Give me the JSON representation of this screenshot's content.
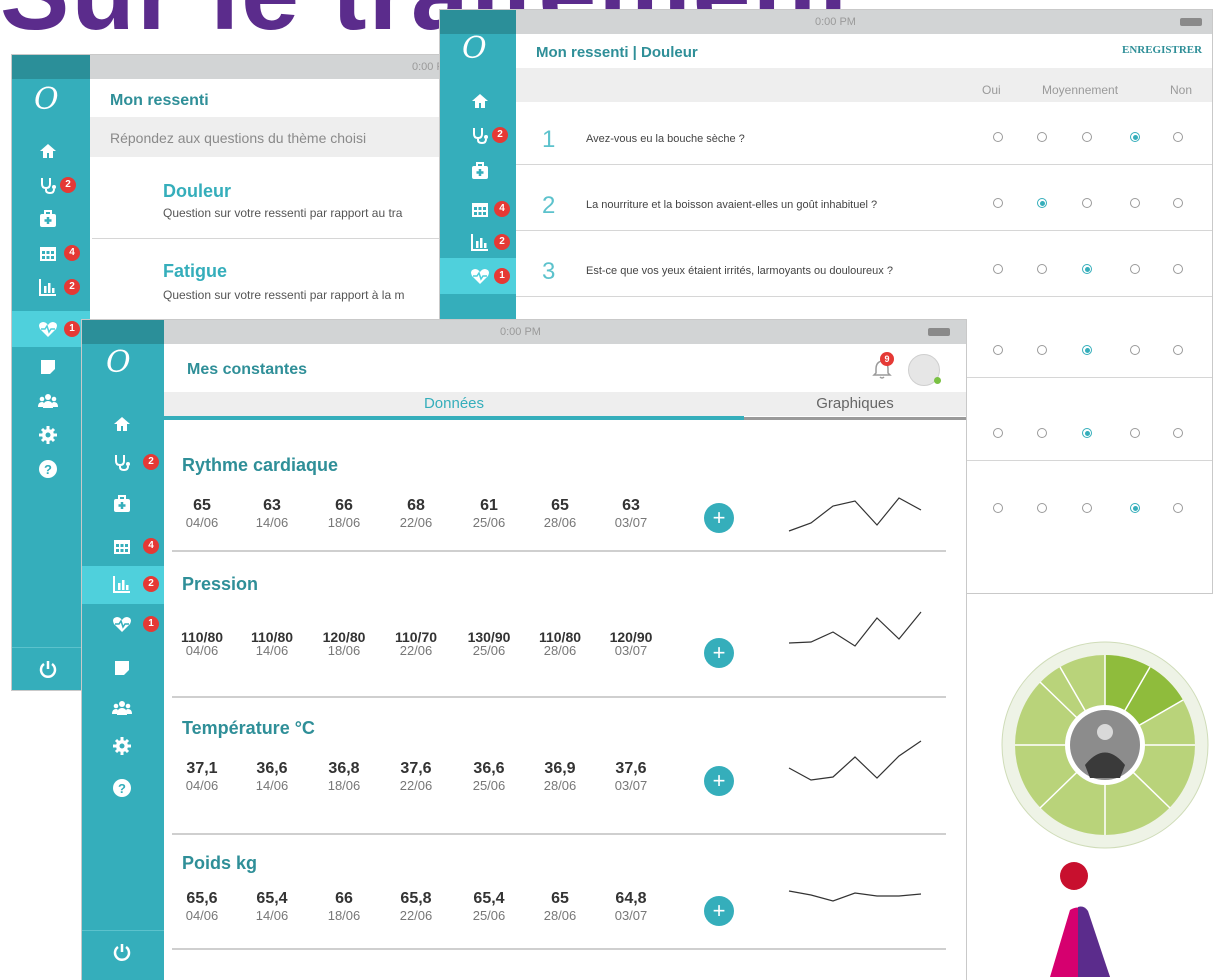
{
  "background_title": "Sur le traitement",
  "status_bar": {
    "time": "0:00 PM",
    "dots": "●●●●○"
  },
  "logo": "O",
  "sidebar_icons": [
    "home-icon",
    "stethoscope-icon",
    "medical-kit-icon",
    "calendar-icon",
    "bar-chart-icon",
    "heart-rate-icon",
    "note-icon",
    "group-icon",
    "settings-icon",
    "help-icon",
    "power-icon"
  ],
  "badges": {
    "stethoscope": "2",
    "calendar": "4",
    "chart": "2",
    "heart": "1",
    "notifications": "9"
  },
  "colors": {
    "accent": "#35aebb",
    "sidebar": "#35aebb",
    "active": "#4fd0dc",
    "badge": "#e53935",
    "title_purple": "#5b2c8c"
  },
  "ressenti": {
    "title": "Mon ressenti",
    "subtitle": "Répondez aux questions du thème choisi",
    "themes": [
      {
        "title": "Douleur",
        "desc": "Question sur votre ressenti par rapport au tra"
      },
      {
        "title": "Fatigue",
        "desc": "Question sur votre ressenti par rapport à la m"
      }
    ]
  },
  "douleur": {
    "title": "Mon ressenti | Douleur",
    "save_label": "ENREGISTRER",
    "columns": [
      "Oui",
      "Moyennement",
      "Non"
    ],
    "questions": [
      {
        "num": "1",
        "text": "Avez-vous eu la bouche sèche ?",
        "selected": 3
      },
      {
        "num": "2",
        "text": "La nourriture et la boisson avaient-elles un goût inhabituel ?",
        "selected": 1
      },
      {
        "num": "3",
        "text": "Est-ce que vos yeux étaient irrités, larmoyants ou douloureux ?",
        "selected": 2
      },
      {
        "num": "",
        "text": "",
        "selected": 2
      },
      {
        "num": "",
        "text": "",
        "selected": 2
      },
      {
        "num": "",
        "text": "",
        "selected": 3
      }
    ]
  },
  "constantes": {
    "title": "Mes constantes",
    "tabs": [
      "Données",
      "Graphiques"
    ],
    "active_tab": 0,
    "add_label": "+",
    "dates": [
      "04/06",
      "14/06",
      "18/06",
      "22/06",
      "25/06",
      "28/06",
      "03/07"
    ],
    "metrics": [
      {
        "name": "Rythme cardiaque",
        "values": [
          "65",
          "63",
          "66",
          "68",
          "61",
          "65",
          "63"
        ],
        "spark": [
          58,
          50,
          33,
          28,
          52,
          25,
          37
        ]
      },
      {
        "name": "Pression",
        "values": [
          "110/80",
          "110/80",
          "120/80",
          "110/70",
          "130/90",
          "110/80",
          "120/90"
        ],
        "spark": [
          39,
          38,
          28,
          42,
          14,
          35,
          8
        ]
      },
      {
        "name": "Température  °C",
        "values": [
          "37,1",
          "36,6",
          "36,8",
          "37,6",
          "36,6",
          "36,9",
          "37,6"
        ],
        "spark": [
          32,
          44,
          41,
          21,
          42,
          20,
          5
        ]
      },
      {
        "name": "Poids  kg",
        "values": [
          "65,6",
          "65,4",
          "66",
          "65,8",
          "65,4",
          "65",
          "64,8"
        ],
        "spark": [
          20,
          24,
          30,
          22,
          25,
          25,
          23
        ]
      }
    ]
  }
}
